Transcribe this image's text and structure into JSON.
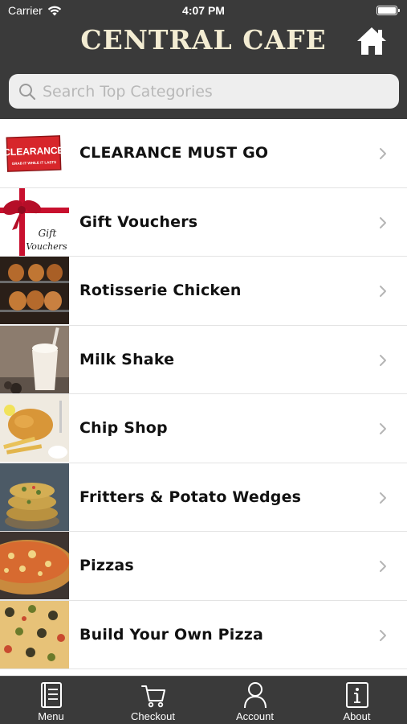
{
  "status": {
    "carrier": "Carrier",
    "time": "4:07 PM"
  },
  "header": {
    "title": "CENTRAL CAFE"
  },
  "search": {
    "placeholder": "Search Top Categories"
  },
  "categories": [
    {
      "label": "CLEARANCE MUST GO",
      "thumb_text": "CLEARANCE",
      "thumb_subtext": "GRAB IT WHILE IT LASTS"
    },
    {
      "label": "Gift Vouchers",
      "thumb_text": "Gift",
      "thumb_subtext": "Vouchers"
    },
    {
      "label": "Rotisserie Chicken"
    },
    {
      "label": "Milk Shake"
    },
    {
      "label": "Chip Shop"
    },
    {
      "label": "Fritters & Potato Wedges"
    },
    {
      "label": "Pizzas"
    },
    {
      "label": "Build Your Own Pizza"
    }
  ],
  "tabbar": {
    "menu": "Menu",
    "checkout": "Checkout",
    "account": "Account",
    "about": "About"
  },
  "colors": {
    "header_bg": "#3a3a3a",
    "title": "#f3ecd2",
    "chevron": "#b5b5b5"
  }
}
